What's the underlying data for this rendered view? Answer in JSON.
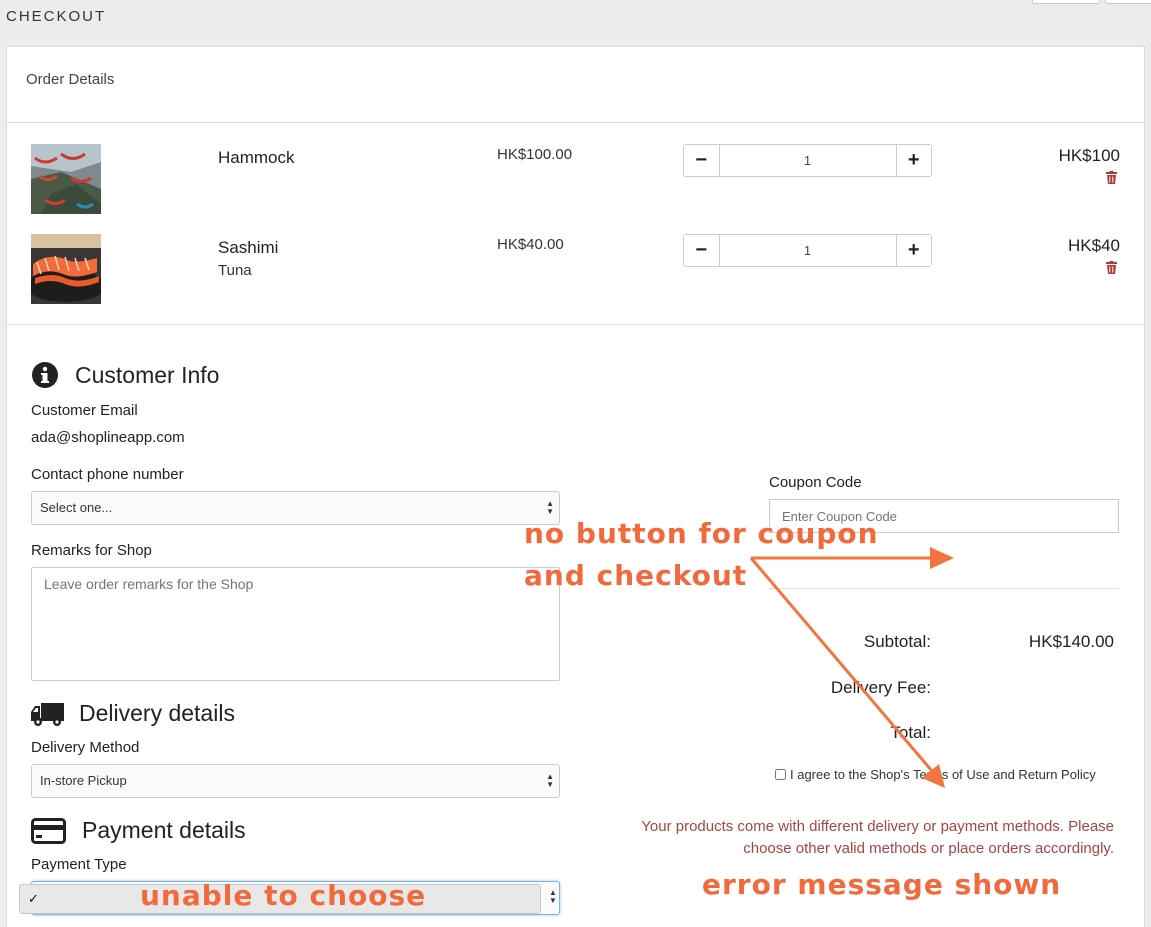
{
  "page": {
    "title": "CHECKOUT"
  },
  "order": {
    "header": "Order Details",
    "items": [
      {
        "name": "Hammock",
        "variant": "",
        "price": "HK$100.00",
        "qty": "1",
        "total": "HK$100"
      },
      {
        "name": "Sashimi",
        "variant": "Tuna",
        "price": "HK$40.00",
        "qty": "1",
        "total": "HK$40"
      }
    ]
  },
  "customer": {
    "title": "Customer Info",
    "email_label": "Customer Email",
    "email_value": "ada@shoplineapp.com",
    "phone_label": "Contact phone number",
    "phone_select": "Select one...",
    "remarks_label": "Remarks for Shop",
    "remarks_placeholder": "Leave order remarks for the Shop"
  },
  "delivery": {
    "title": "Delivery details",
    "method_label": "Delivery Method",
    "method_value": "In-store Pickup"
  },
  "payment": {
    "title": "Payment details",
    "type_label": "Payment Type",
    "type_value": "✓"
  },
  "coupon": {
    "label": "Coupon Code",
    "placeholder": "Enter Coupon Code"
  },
  "summary": {
    "subtotal_label": "Subtotal:",
    "subtotal_value": "HK$140.00",
    "delivery_label": "Delivery Fee:",
    "total_label": "Total:",
    "agree_text": "I agree to the Shop's Terms of Use and Return Policy",
    "error_line1": "Your products come with different delivery or payment methods. Please",
    "error_line2": "choose other valid methods or place orders accordingly."
  },
  "annotations": {
    "coupon_line1": "no button for coupon",
    "coupon_line2": "and checkout",
    "payment": "unable to choose",
    "error": "error message shown",
    "color": "#f26a3b"
  },
  "colors": {
    "error": "#a94442",
    "trash": "#b03a3a"
  }
}
